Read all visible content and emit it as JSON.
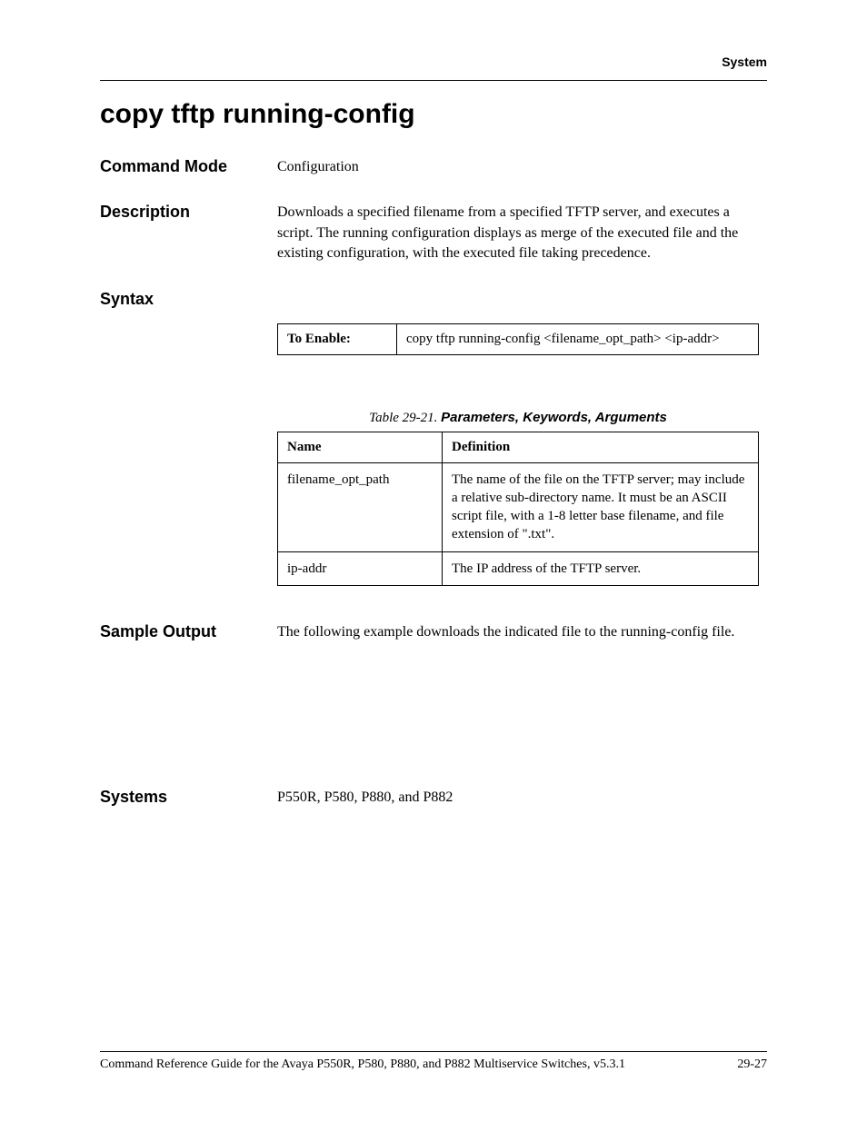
{
  "header": {
    "section": "System"
  },
  "title": "copy tftp running-config",
  "sections": {
    "command_mode": {
      "label": "Command Mode",
      "value": "Configuration"
    },
    "description": {
      "label": "Description",
      "value": "Downloads a specified filename from a specified TFTP server, and executes a script. The running configuration displays as merge of the executed file and the existing configuration, with the executed file taking precedence."
    },
    "syntax": {
      "label": "Syntax",
      "enable_label": "To Enable:",
      "enable_value": "copy tftp running-config <filename_opt_path> <ip-addr>"
    },
    "params_table": {
      "caption_prefix": "Table 29-21.  ",
      "caption_title": "Parameters, Keywords, Arguments",
      "headers": {
        "name": "Name",
        "definition": "Definition"
      },
      "rows": [
        {
          "name": "filename_opt_path",
          "definition": "The name of the file on the TFTP server; may include a relative sub-directory name. It must be an ASCII script file, with a 1-8 letter base filename, and file extension of \".txt\"."
        },
        {
          "name": "ip-addr",
          "definition": "The IP address of the TFTP server."
        }
      ]
    },
    "sample_output": {
      "label": "Sample Output",
      "value": "The following example downloads the indicated file to the running-config file."
    },
    "systems": {
      "label": "Systems",
      "value": "P550R, P580, P880, and P882"
    }
  },
  "footer": {
    "text": "Command Reference Guide for the Avaya P550R, P580, P880, and P882 Multiservice Switches, v5.3.1",
    "page": "29-27"
  }
}
